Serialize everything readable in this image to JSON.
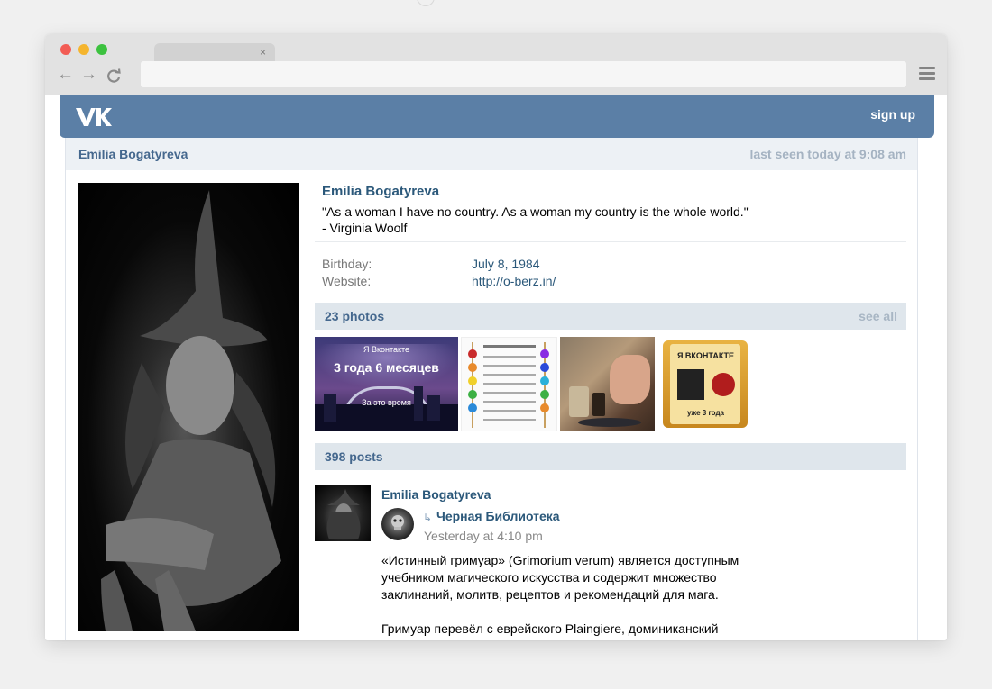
{
  "browser": {
    "tab_close": "×",
    "nav": {
      "back": "←",
      "forward": "→",
      "reload": "C"
    }
  },
  "header": {
    "logo": "VK",
    "signup": "sign up"
  },
  "profile": {
    "bar_name": "Emilia Bogatyreva",
    "last_seen": "last seen today at 9:08 am",
    "name": "Emilia Bogatyreva",
    "quote_line1": "\"As a woman I have no country. As a woman my country is the whole world.\"",
    "quote_line2": "- Virginia Woolf",
    "birthday_label": "Birthday:",
    "birthday_value": "July 8, 1984",
    "website_label": "Website:",
    "website_value": "http://o-berz.in/"
  },
  "photos": {
    "title": "23 photos",
    "see_all": "see all",
    "photo1": {
      "line1": "Я Вконтакте",
      "line2": "3 года 6 месяцев",
      "line3": "За это время"
    },
    "photo4": {
      "top": "Я ВКОНТАКТЕ",
      "bottom": "уже 3 года"
    }
  },
  "posts": {
    "title": "398 posts",
    "author": "Emilia Bogatyreva",
    "repost_icon": "↳",
    "repost_source": "Черная Библиотека",
    "time": "Yesterday at 4:10 pm",
    "paragraph1": "«Истинный гримуар» (Grimorium verum) является доступным учебником магического искусства и содержит множество заклинаний, молитв, рецептов и рекомендаций для мага.",
    "paragraph2": "Гримуар перевёл с еврейского Plaingiere, доминиканский монах, вместе с Собранием Любопытных Тайн."
  },
  "colors": {
    "vk_header": "#5b7fa6",
    "link": "#2b587a",
    "section_bar": "#dfe6ec",
    "profile_bar": "#edf1f5"
  }
}
